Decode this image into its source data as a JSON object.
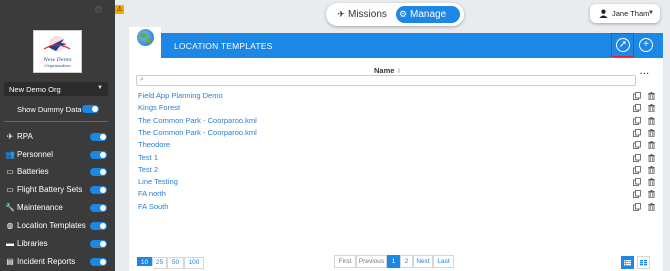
{
  "colors": {
    "accent": "#1c87e5",
    "sidebar": "#3b3b3b",
    "highlight": "#d9232e"
  },
  "sidebar": {
    "org_select": "New Demo Org",
    "dummy_label": "Show Dummy Data",
    "logo_text": "New Demo Organisation",
    "items": [
      {
        "label": "RPA",
        "icon": "plane-icon"
      },
      {
        "label": "Personnel",
        "icon": "users-icon"
      },
      {
        "label": "Batteries",
        "icon": "battery-icon"
      },
      {
        "label": "Flight Battery Sets",
        "icon": "battery-set-icon"
      },
      {
        "label": "Maintenance",
        "icon": "wrench-icon"
      },
      {
        "label": "Location Templates",
        "icon": "globe-icon"
      },
      {
        "label": "Libraries",
        "icon": "folder-icon"
      },
      {
        "label": "Incident Reports",
        "icon": "clipboard-icon"
      }
    ]
  },
  "topbar": {
    "missions": "Missions",
    "manage": "Manage",
    "user": "Jane Tham"
  },
  "header": {
    "title": "LOCATION TEMPLATES"
  },
  "table": {
    "column": "Name",
    "more": "...",
    "search_placeholder": "",
    "rows": [
      "Field App Planning Demo",
      "Kings Forest",
      "The Common Park - Coorparoo.kml",
      "The Common Park - Coorparoo.kml",
      "Theodore",
      "Test 1",
      "Test 2",
      "Line Testing",
      "FA north",
      "FA South"
    ]
  },
  "pagination": {
    "sizes": [
      "10",
      "25",
      "50",
      "100"
    ],
    "first": "First",
    "previous": "Previous",
    "pages": [
      "1",
      "2"
    ],
    "next": "Next",
    "last": "Last"
  }
}
